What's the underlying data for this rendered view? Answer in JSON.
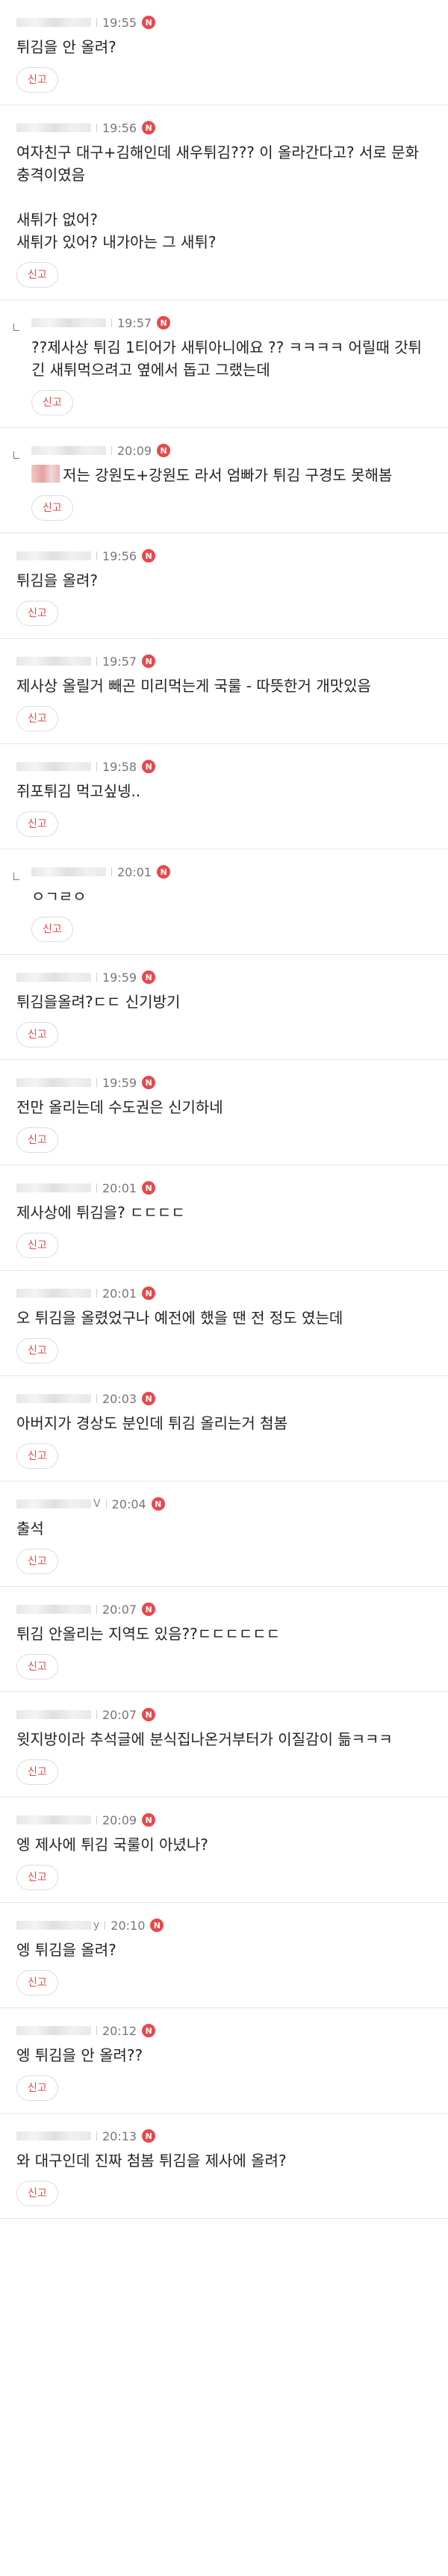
{
  "ui": {
    "report_label": "신고",
    "new_badge": "N"
  },
  "comments": [
    {
      "reply": false,
      "nick_tail": "",
      "time": "19:55",
      "text": "튀김을 안 올려?"
    },
    {
      "reply": false,
      "nick_tail": "",
      "time": "19:56",
      "text": "여자친구 대구+김해인데 새우튀김??? 이 올라간다고? 서로 문화 충격이였음\n\n새튀가 없어?\n새튀가 있어? 내가아는 그 새튀?"
    },
    {
      "reply": true,
      "nick_tail": "",
      "time": "19:57",
      "text": "??제사상 튀김 1티어가 새튀아니에요 ?? ㅋㅋㅋㅋ 어릴때 갓튀긴 새튀먹으려고 옆에서 돕고 그랬는데"
    },
    {
      "reply": true,
      "nick_tail": "",
      "time": "20:09",
      "thumb": true,
      "text": "저는 강원도+강원도 라서 엄빠가 튀김 구경도 못해봄"
    },
    {
      "reply": false,
      "nick_tail": "",
      "time": "19:56",
      "text": "튀김을 올려?"
    },
    {
      "reply": false,
      "nick_tail": "",
      "time": "19:57",
      "text": "제사상 올릴거 빼곤 미리먹는게 국룰 - 따뜻한거 개맛있음"
    },
    {
      "reply": false,
      "nick_tail": "",
      "time": "19:58",
      "text": "쥐포튀김 먹고싶넹.."
    },
    {
      "reply": true,
      "nick_tail": "",
      "time": "20:01",
      "text": "ㅇㄱㄹㅇ"
    },
    {
      "reply": false,
      "nick_tail": "",
      "time": "19:59",
      "text": "튀김을올려?ㄷㄷ 신기방기"
    },
    {
      "reply": false,
      "nick_tail": "",
      "time": "19:59",
      "text": "전만 올리는데 수도권은 신기하네"
    },
    {
      "reply": false,
      "nick_tail": "",
      "time": "20:01",
      "text": "제사상에 튀김을? ㄷㄷㄷㄷ"
    },
    {
      "reply": false,
      "nick_tail": "",
      "time": "20:01",
      "text": "오 튀김을 올렸었구나 예전에 했을 땐 전 정도 였는데"
    },
    {
      "reply": false,
      "nick_tail": "",
      "time": "20:03",
      "text": "아버지가 경상도 분인데 튀김 올리는거 첨봄"
    },
    {
      "reply": false,
      "nick_tail": "V",
      "time": "20:04",
      "text": "출석"
    },
    {
      "reply": false,
      "nick_tail": "",
      "time": "20:07",
      "text": "튀김 안올리는 지역도 있음??ㄷㄷㄷㄷㄷㄷ"
    },
    {
      "reply": false,
      "nick_tail": "",
      "time": "20:07",
      "text": "윗지방이라 추석글에 분식집나온거부터가 이질감이 듦ㅋㅋㅋ"
    },
    {
      "reply": false,
      "nick_tail": "",
      "time": "20:09",
      "text": "엥 제사에 튀김 국룰이 아녔나?"
    },
    {
      "reply": false,
      "nick_tail": "y",
      "time": "20:10",
      "text": "엥 튀김을 올려?"
    },
    {
      "reply": false,
      "nick_tail": "",
      "time": "20:12",
      "text": "엥 튀김을 안 올려??"
    },
    {
      "reply": false,
      "nick_tail": "",
      "time": "20:13",
      "text": "와 대구인데 진짜 첨봄 튀김을 제사에 올려?"
    }
  ]
}
